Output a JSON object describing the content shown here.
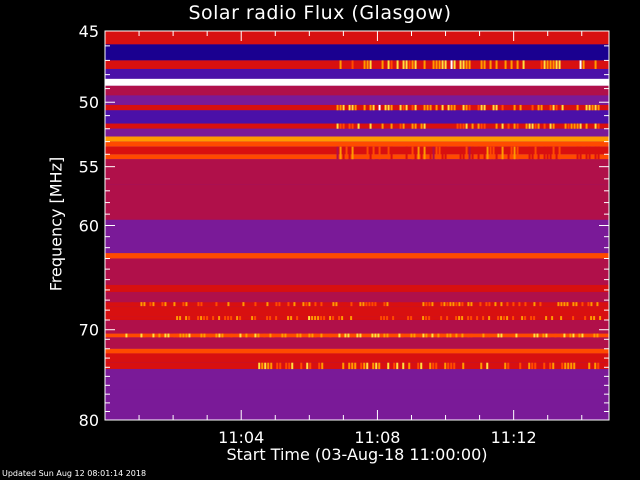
{
  "page": {
    "footer": "Updated Sun Aug 12 08:01:14 2018"
  },
  "chart_data": {
    "type": "heatmap",
    "title": "Solar radio Flux (Glasgow)",
    "xlabel": "Start Time (03-Aug-18 11:00:00)",
    "ylabel": "Frequency [MHz]",
    "x_unit": "minutes after 11:00:00",
    "xlim": [
      0,
      14.8
    ],
    "ylim": [
      45,
      80
    ],
    "y_scale": "log",
    "y_inverted": true,
    "xticks": [
      {
        "value": 4,
        "label": "11:04"
      },
      {
        "value": 8,
        "label": "11:08"
      },
      {
        "value": 12,
        "label": "11:12"
      }
    ],
    "yticks": [
      {
        "value": 45,
        "label": "45"
      },
      {
        "value": 50,
        "label": "50"
      },
      {
        "value": 55,
        "label": "55"
      },
      {
        "value": 60,
        "label": "60"
      },
      {
        "value": 70,
        "label": "70"
      },
      {
        "value": 80,
        "label": "80"
      }
    ],
    "colormap": [
      "#1a0090",
      "#4b10a8",
      "#7a1a98",
      "#b0104a",
      "#d81010",
      "#ff4a00",
      "#ff9a00",
      "#ffe040",
      "#ffffff"
    ],
    "bands": [
      {
        "from": 45.0,
        "to": 45.9,
        "level": 0.45
      },
      {
        "from": 45.9,
        "to": 47.0,
        "level": 0.05
      },
      {
        "from": 47.0,
        "to": 47.6,
        "level": 0.55
      },
      {
        "from": 47.6,
        "to": 48.3,
        "level": 0.08
      },
      {
        "from": 48.3,
        "to": 48.8,
        "level": 0.98
      },
      {
        "from": 48.8,
        "to": 49.5,
        "level": 0.35
      },
      {
        "from": 49.5,
        "to": 50.2,
        "level": 0.2
      },
      {
        "from": 50.2,
        "to": 50.6,
        "level": 0.55
      },
      {
        "from": 50.6,
        "to": 51.6,
        "level": 0.12
      },
      {
        "from": 51.6,
        "to": 52.0,
        "level": 0.5
      },
      {
        "from": 52.0,
        "to": 52.6,
        "level": 0.2
      },
      {
        "from": 52.6,
        "to": 53.0,
        "level": 0.8
      },
      {
        "from": 53.0,
        "to": 53.4,
        "level": 0.62
      },
      {
        "from": 53.4,
        "to": 54.0,
        "level": 0.45
      },
      {
        "from": 54.0,
        "to": 54.4,
        "level": 0.58
      },
      {
        "from": 54.4,
        "to": 56.5,
        "level": 0.42
      },
      {
        "from": 56.5,
        "to": 59.5,
        "level": 0.36
      },
      {
        "from": 59.5,
        "to": 62.5,
        "level": 0.3
      },
      {
        "from": 62.5,
        "to": 63.0,
        "level": 0.62
      },
      {
        "from": 63.0,
        "to": 65.5,
        "level": 0.33
      },
      {
        "from": 65.5,
        "to": 66.2,
        "level": 0.5
      },
      {
        "from": 66.2,
        "to": 67.2,
        "level": 0.4
      },
      {
        "from": 67.2,
        "to": 67.6,
        "level": 0.55
      },
      {
        "from": 67.6,
        "to": 68.6,
        "level": 0.45
      },
      {
        "from": 68.6,
        "to": 69.0,
        "level": 0.55
      },
      {
        "from": 69.0,
        "to": 70.4,
        "level": 0.4
      },
      {
        "from": 70.4,
        "to": 70.8,
        "level": 0.6
      },
      {
        "from": 70.8,
        "to": 72.0,
        "level": 0.38
      },
      {
        "from": 72.0,
        "to": 72.5,
        "level": 0.62
      },
      {
        "from": 72.5,
        "to": 73.5,
        "level": 0.5
      },
      {
        "from": 73.5,
        "to": 74.2,
        "level": 0.55
      },
      {
        "from": 74.2,
        "to": 76.5,
        "level": 0.3
      },
      {
        "from": 76.5,
        "to": 78.5,
        "level": 0.26
      },
      {
        "from": 78.5,
        "to": 80.0,
        "level": 0.22
      }
    ],
    "bursts": [
      {
        "from": 47.0,
        "to": 47.6,
        "x_start": 6.8,
        "x_end": 14.6,
        "level": 0.95
      },
      {
        "from": 50.2,
        "to": 50.6,
        "x_start": 6.8,
        "x_end": 14.6,
        "level": 0.95
      },
      {
        "from": 51.6,
        "to": 52.0,
        "x_start": 6.8,
        "x_end": 14.6,
        "level": 0.85
      },
      {
        "from": 53.4,
        "to": 54.4,
        "x_start": 6.8,
        "x_end": 14.6,
        "level": 0.72
      },
      {
        "from": 67.2,
        "to": 67.6,
        "x_start": 0.6,
        "x_end": 14.6,
        "level": 0.8
      },
      {
        "from": 68.6,
        "to": 69.0,
        "x_start": 2.0,
        "x_end": 14.6,
        "level": 0.82
      },
      {
        "from": 70.4,
        "to": 70.8,
        "x_start": 0.6,
        "x_end": 14.6,
        "level": 0.9
      },
      {
        "from": 73.5,
        "to": 74.2,
        "x_start": 4.5,
        "x_end": 14.6,
        "level": 0.88
      }
    ]
  }
}
